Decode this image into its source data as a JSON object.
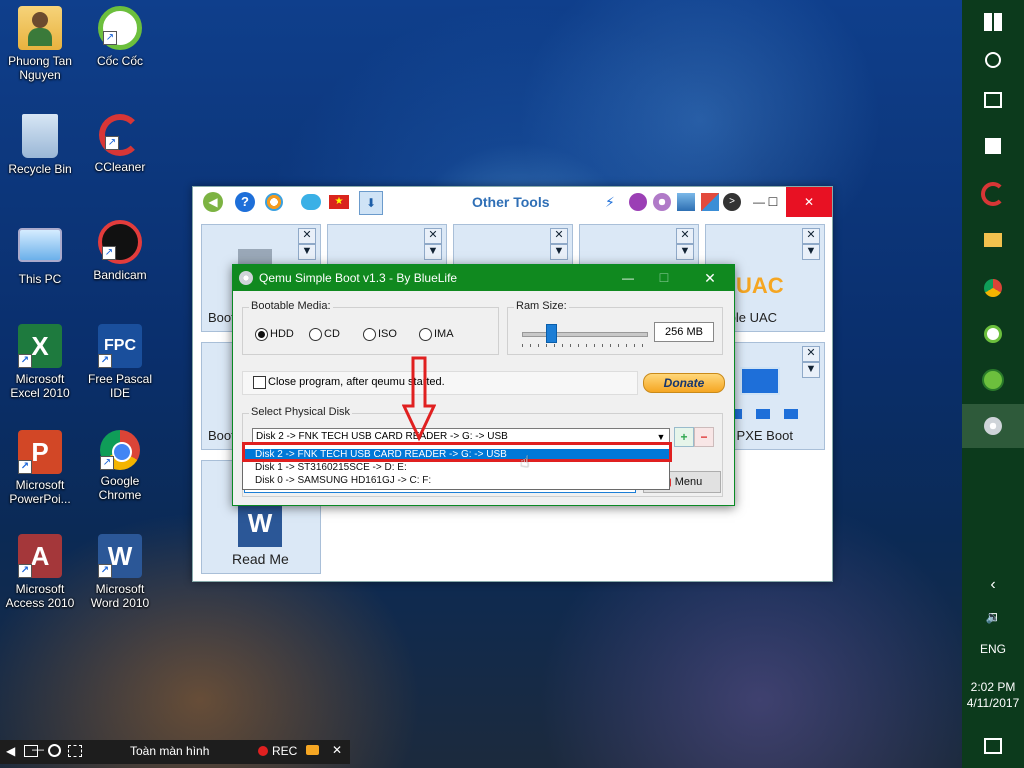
{
  "desktop_icons": [
    {
      "label": "Phuong Tan\nNguyen"
    },
    {
      "label": "Cốc Cốc"
    },
    {
      "label": "Recycle Bin"
    },
    {
      "label": "CCleaner"
    },
    {
      "label": "This PC"
    },
    {
      "label": "Bandicam"
    },
    {
      "label": "Microsoft\nExcel 2010"
    },
    {
      "label": "Free Pascal\nIDE"
    },
    {
      "label": "Microsoft\nPowerPoi..."
    },
    {
      "label": "Google\nChrome"
    },
    {
      "label": "Microsoft\nAccess 2010"
    },
    {
      "label": "Microsoft\nWord 2010"
    }
  ],
  "other_tools": {
    "title": "Other Tools",
    "tiles": [
      {
        "label": "Boot"
      },
      {
        "label": "Boot"
      },
      {
        "label": "isable UAC"
      },
      {
        "label": "mei PXE Boot"
      },
      {
        "label": "Read Me"
      }
    ],
    "uac_art_text": "UAC",
    "win_minimize": "—",
    "win_maximize": "☐",
    "win_close": "✕"
  },
  "qemu": {
    "title": "Qemu Simple Boot v1.3 - By BlueLife",
    "bootable_media_label": "Bootable Media:",
    "media_options": [
      "HDD",
      "CD",
      "ISO",
      "IMA"
    ],
    "selected_media": "HDD",
    "ram_label": "Ram Size:",
    "ram_value": "256 MB",
    "close_checkbox_label": "Close program, after qeumu started.",
    "donate_label": "Donate",
    "select_disk_label": "Select Physical Disk",
    "selected_disk": "Disk 2 -> FNK TECH USB CARD READER -> G: -> USB",
    "disk_options": [
      "Disk 2 -> FNK TECH USB CARD READER -> G: -> USB",
      "Disk 1 -> ST3160215SCE -> D: E:",
      "Disk 0 -> SAMSUNG HD161GJ -> C: F:"
    ],
    "menu_button": "Menu",
    "add_label": "+",
    "remove_label": "−",
    "close_label": "✕",
    "minimize_label": "—",
    "maximize_label": "☐"
  },
  "taskbar": {
    "language": "ENG",
    "time": "2:02 PM",
    "date": "4/11/2017"
  },
  "recorder": {
    "fullscreen_label": "Toàn màn hình",
    "rec_label": "REC"
  },
  "colors": {
    "accent_red": "#e02020",
    "qemu_green": "#10891f",
    "selection_blue": "#0078d7"
  }
}
